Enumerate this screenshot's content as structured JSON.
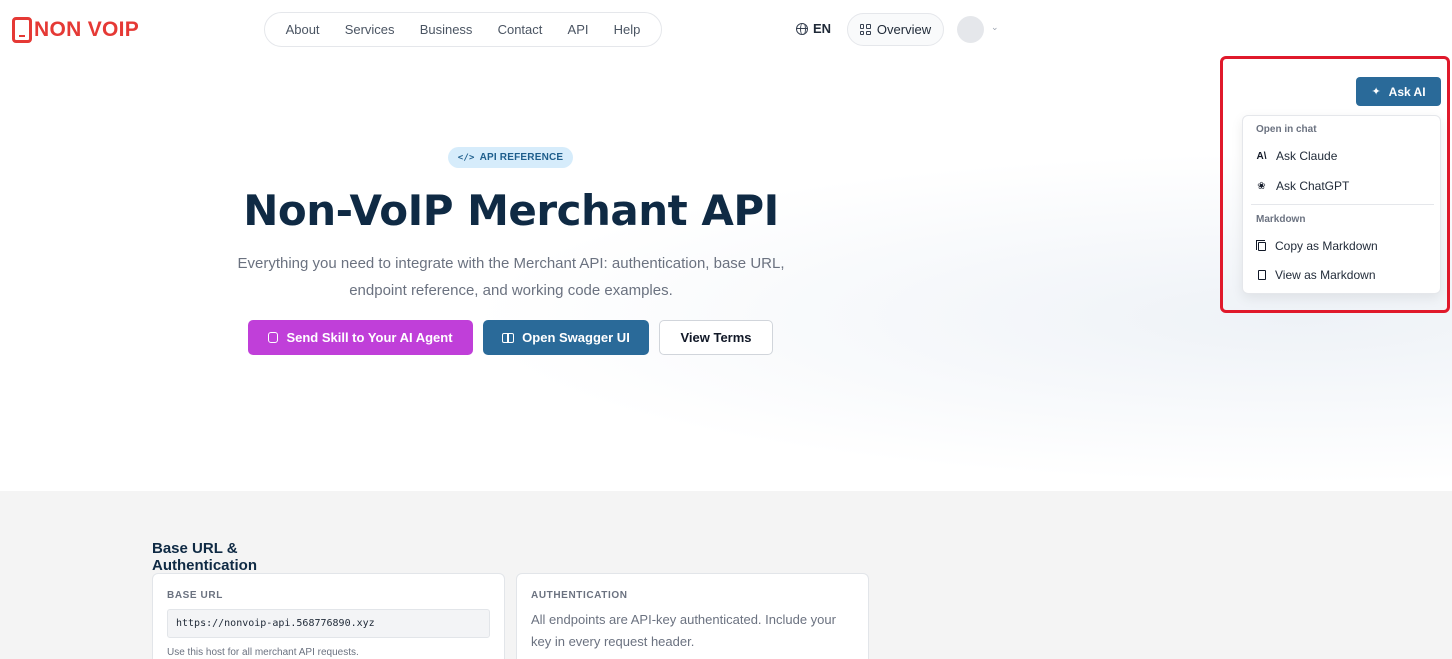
{
  "header": {
    "logo_text": "NON VOIP",
    "nav": [
      "About",
      "Services",
      "Business",
      "Contact",
      "API",
      "Help"
    ],
    "language": "EN",
    "overview_label": "Overview"
  },
  "hero": {
    "badge": "API REFERENCE",
    "title": "Non-VoIP Merchant API",
    "subtitle": "Everything you need to integrate with the Merchant API: authentication, base URL, endpoint reference, and working code examples.",
    "buttons": {
      "skill": "Send Skill to Your AI Agent",
      "swagger": "Open Swagger UI",
      "terms": "View Terms"
    }
  },
  "section": {
    "title": "Base URL & Authentication",
    "base_url": {
      "label": "BASE URL",
      "value": "https://nonvoip-api.568776890.xyz",
      "hint": "Use this host for all merchant API requests."
    },
    "auth": {
      "label": "AUTHENTICATION",
      "text": "All endpoints are API-key authenticated. Include your key in every request header."
    }
  },
  "ask_ai": {
    "button_label": "Ask AI",
    "groups": [
      {
        "label": "Open in chat",
        "items": [
          {
            "label": "Ask Claude",
            "icon": "claude-icon"
          },
          {
            "label": "Ask ChatGPT",
            "icon": "chatgpt-icon"
          }
        ]
      },
      {
        "label": "Markdown",
        "items": [
          {
            "label": "Copy as Markdown",
            "icon": "copy-icon"
          },
          {
            "label": "View as Markdown",
            "icon": "document-icon"
          }
        ]
      }
    ]
  },
  "colors": {
    "brand_red": "#e53935",
    "primary_blue": "#2a6a99",
    "skill_purple": "#c03fd9",
    "highlight_red": "#e0192b",
    "title_navy": "#0f2a44"
  }
}
